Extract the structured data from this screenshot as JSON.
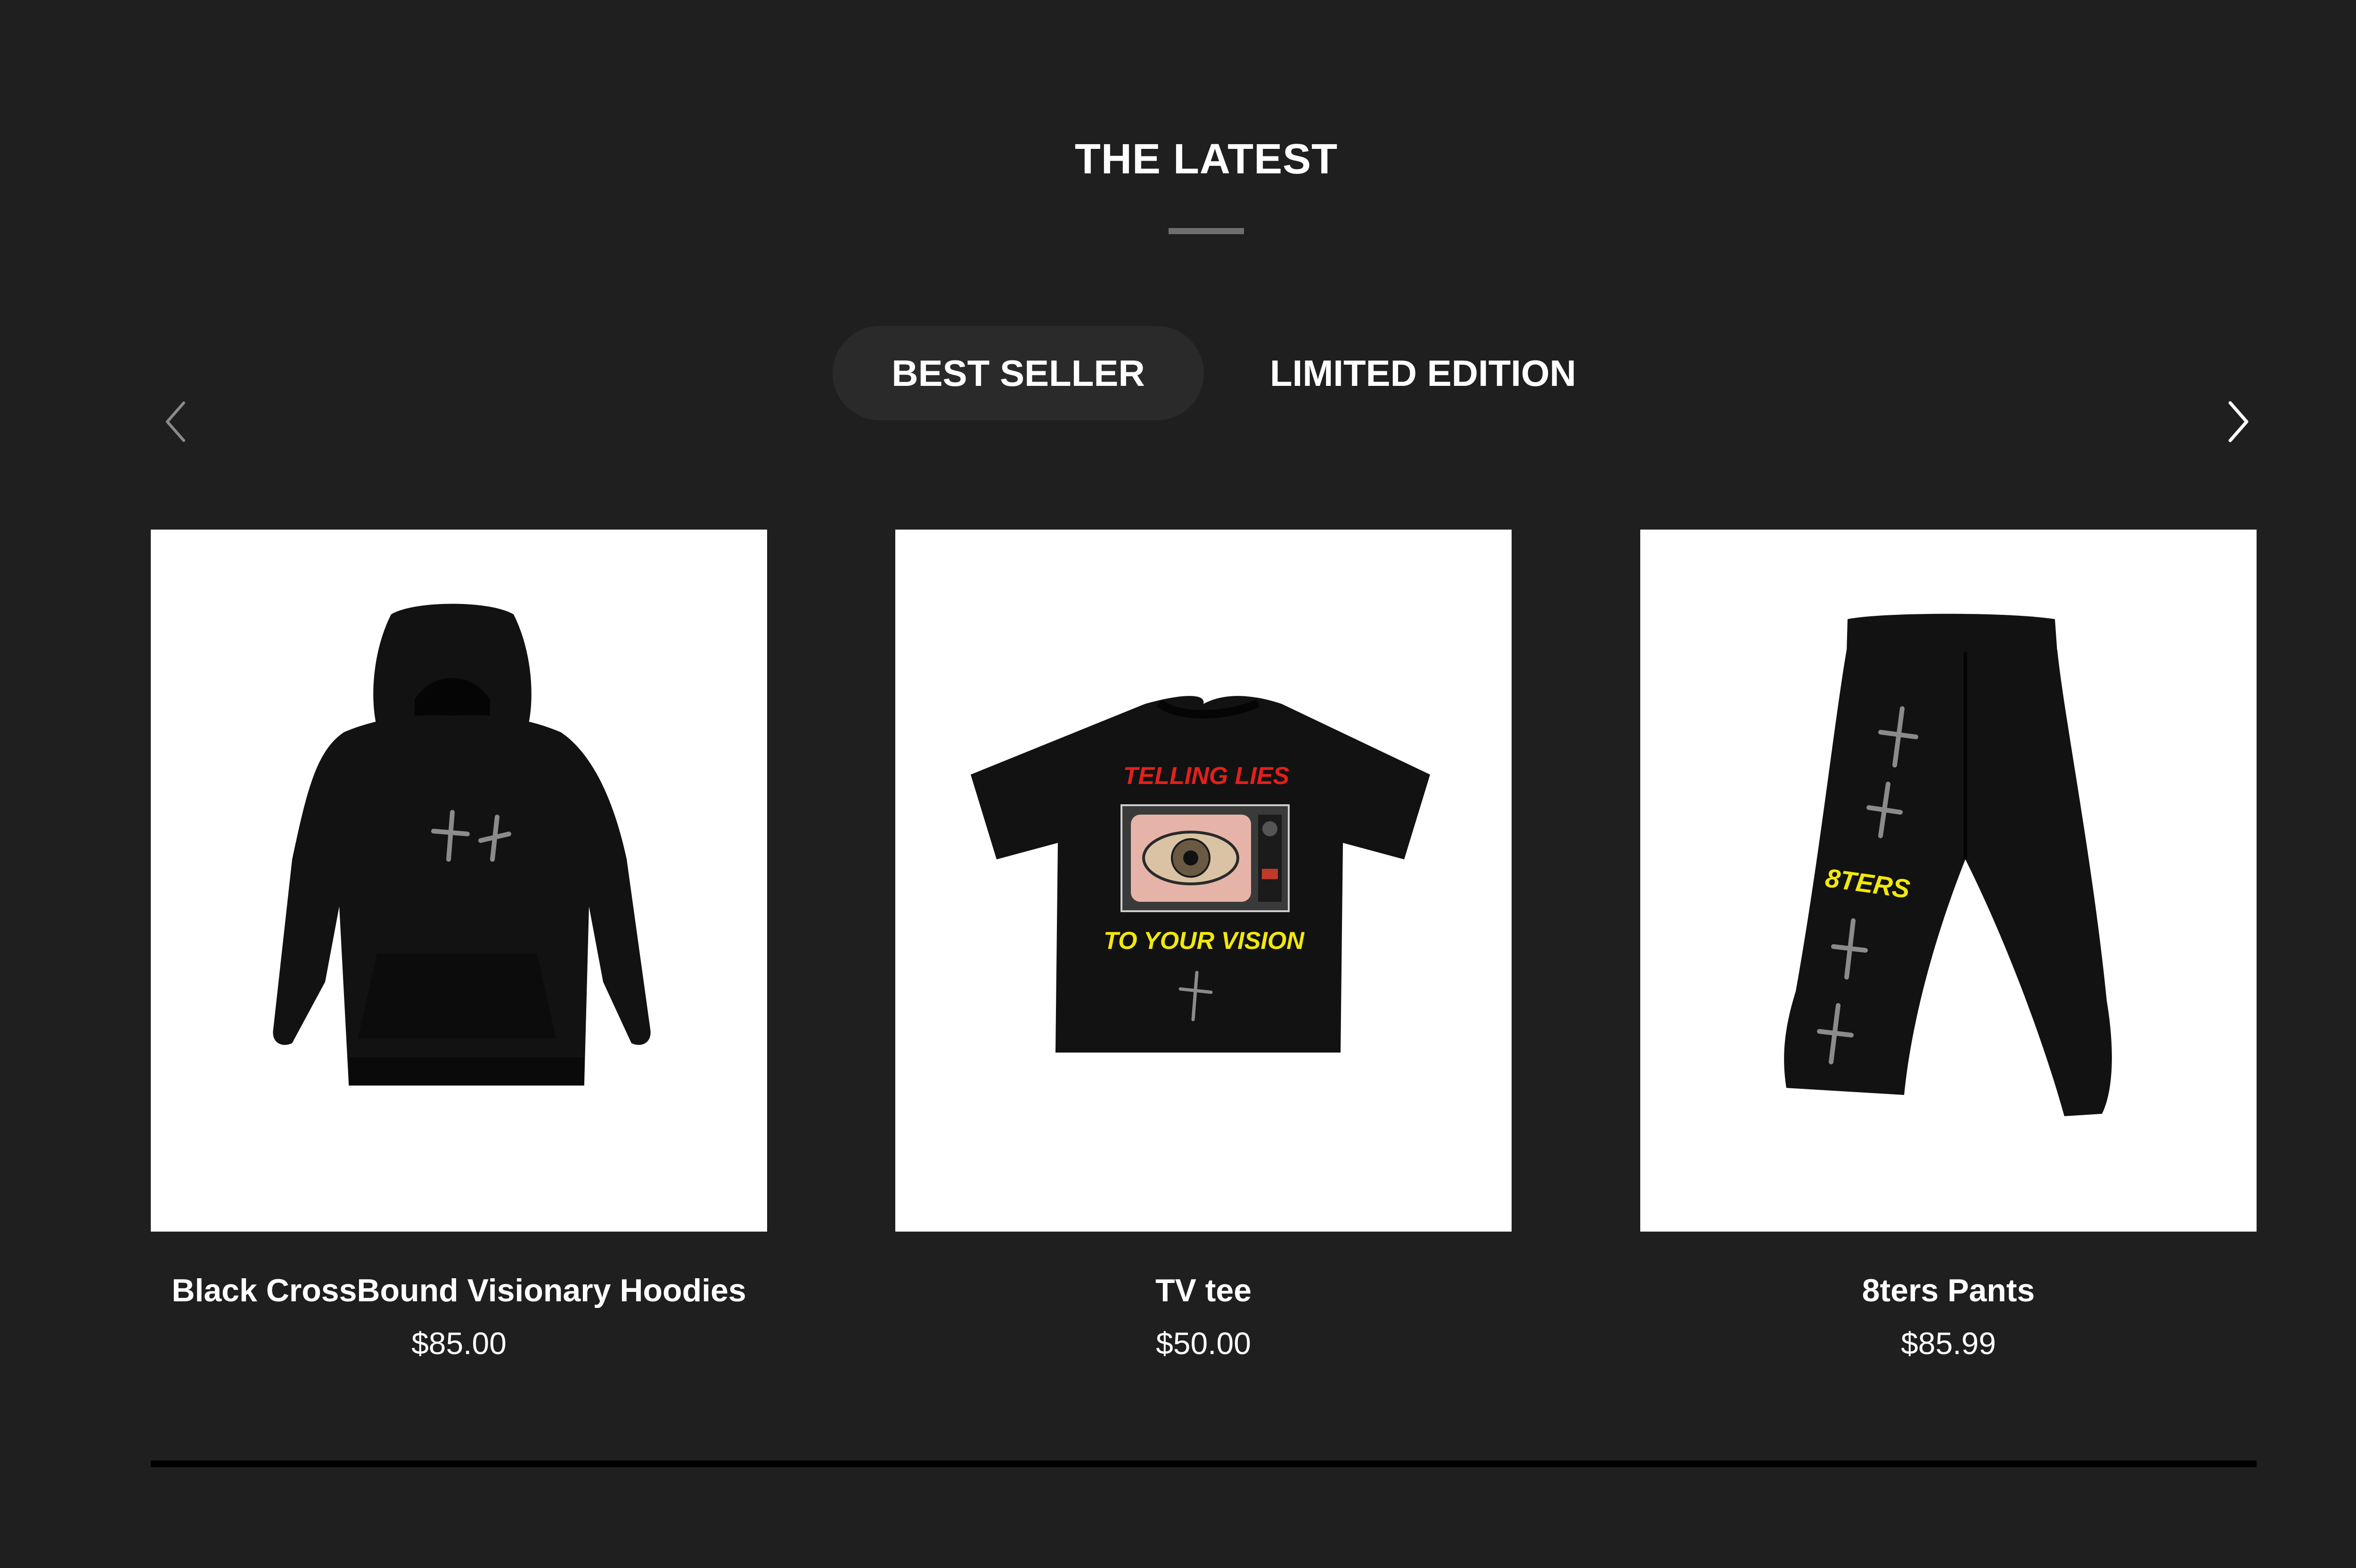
{
  "section": {
    "title": "THE LATEST"
  },
  "tabs": [
    {
      "label": "BEST SELLER",
      "active": true
    },
    {
      "label": "LIMITED EDITION",
      "active": false
    }
  ],
  "carousel": {
    "prev_icon": "chevron-left-icon",
    "next_icon": "chevron-right-icon"
  },
  "products": [
    {
      "name": "Black CrossBound Visionary Hoodies",
      "price": "$85.00",
      "image": "black-hoodie-image"
    },
    {
      "name": "TV tee",
      "price": "$50.00",
      "image": "tv-tee-image",
      "print_top": "TELLING  LIES",
      "print_bottom": "TO YOUR VISION"
    },
    {
      "name": "8ters Pants",
      "price": "$85.99",
      "image": "black-pants-image",
      "print": "8TERS"
    }
  ],
  "colors": {
    "background": "#1f1f1f",
    "active_tab": "#2a2a2a",
    "card_background": "#ffffff",
    "garment": "#121212",
    "print_red": "#e3201b",
    "print_yellow": "#f1e80c"
  }
}
